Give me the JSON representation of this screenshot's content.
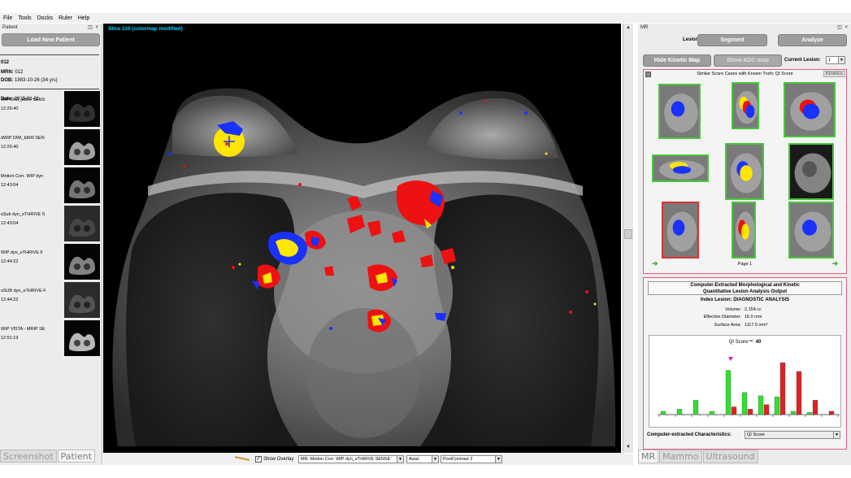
{
  "menubar": {
    "items": [
      "File",
      "Tools",
      "Docks",
      "Ruler",
      "Help"
    ]
  },
  "patient_panel": {
    "title": "Patient",
    "controls": "×",
    "load_button": "Load New Patient",
    "patient_id": "012",
    "mrn_label": "MRN:",
    "mrn": "012",
    "dob_label": "DOB:",
    "dob": "1983-10-26 (34 yrs)",
    "date_label": "Date:",
    "date": "2015-01-01",
    "series": [
      {
        "name": "WIP DWI_b800 SENS",
        "time": "12:26:40"
      },
      {
        "name": "dWIP DWI_b800 SEN",
        "time": "12:26:40"
      },
      {
        "name": "Motion Corr. WIP dyn",
        "time": "12:43:04"
      },
      {
        "name": "sSub dyn_eTHRIVE S",
        "time": "12:43:04"
      },
      {
        "name": "WIP dyn_eTHRIVE F",
        "time": "12:44:22"
      },
      {
        "name": "sSUB dyn_eTHRIVE F",
        "time": "12:44:22"
      },
      {
        "name": "WIP VISTA - MRIP SE",
        "time": "12:51:19"
      }
    ],
    "tabs": [
      "Screenshot",
      "Patient"
    ]
  },
  "viewer": {
    "slice_label": "Slice 110 (colormap modified)"
  },
  "bottom_bar": {
    "show_overlay_label": "Show Overlay",
    "series_select": "MR: Motion Corr. WIP dyn_eTHRIVE SENSE",
    "orientation_select": "Axial",
    "phase_select": "PostContrast 2"
  },
  "mr_panel": {
    "title": "MR",
    "lesion_label": "Lesion:",
    "segment_button": "Segment",
    "analyze_button": "Analyze",
    "hide_kinetic_button": "Hide Kinetic Map",
    "show_adc_button": "Show ADC map",
    "current_lesion_label": "Current Lesion:",
    "current_lesion_value": "1",
    "similar_title": "Similar Score Cases with Known Truth: QI Score",
    "kinetics_tab": "Kinetics",
    "similar_cases": [
      {
        "border": "green"
      },
      {
        "border": "green"
      },
      {
        "border": "green"
      },
      {
        "border": "green"
      },
      {
        "border": "green"
      },
      {
        "border": "green"
      },
      {
        "border": "red"
      },
      {
        "border": "green"
      },
      {
        "border": "green"
      }
    ],
    "page_label": "Page 1",
    "analysis_title_1": "Computer-Extracted Morphological and Kinetic",
    "analysis_title_2": "Quantitative Lesion Analysis Output",
    "index_lesion": "Index Lesion: DIAGNOSTIC ANALYSIS",
    "volume_label": "Volume:",
    "volume_value": "2.154 cc",
    "diameter_label": "Effective Diameter:",
    "diameter_value": "16.0 mm",
    "surface_label": "Surface Area:",
    "surface_value": "1117.5 mm²",
    "qi_score_label": "QI Score™:",
    "qi_score_value": "40",
    "characteristics_label": "Computer-extracted Characteristics:",
    "characteristics_select": "QI Score",
    "tabs": [
      "MR",
      "Mammo",
      "Ultrasound"
    ]
  },
  "chart_data": {
    "type": "bar",
    "title": "QI Score™: 40",
    "xlabel": "",
    "ylabel": "",
    "series": [
      {
        "color": "#33dd33",
        "values": [
          0.03,
          0.05,
          0.13,
          0.03,
          0.4,
          0.2,
          0.17,
          0.16,
          0.03,
          0.02,
          0.0
        ]
      },
      {
        "color": "#dd2222",
        "values": [
          0.0,
          0.0,
          0.0,
          0.0,
          0.07,
          0.05,
          0.09,
          0.47,
          0.39,
          0.13,
          0.03
        ]
      }
    ],
    "marker_value": 0.4,
    "grid": false,
    "legend": "none"
  }
}
